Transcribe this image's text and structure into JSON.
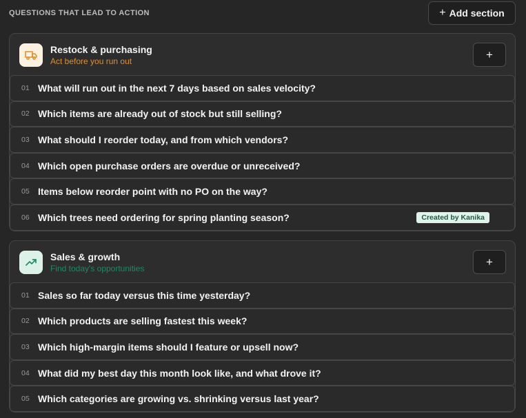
{
  "header": {
    "title": "QUESTIONS THAT LEAD TO ACTION",
    "add_section_label": "Add section",
    "add_icon": "+"
  },
  "sections": [
    {
      "title": "Restock & purchasing",
      "subtitle": "Act before you run out",
      "icon": "truck-icon",
      "accent": "#e0902e",
      "icon_bg": "#fdf1df",
      "add_label": "+",
      "questions": [
        {
          "num": "01",
          "text": "What will run out in the next 7 days based on sales velocity?"
        },
        {
          "num": "02",
          "text": "Which items are already out of stock but still selling?"
        },
        {
          "num": "03",
          "text": "What should I reorder today, and from which vendors?"
        },
        {
          "num": "04",
          "text": "Which open purchase orders are overdue or unreceived?"
        },
        {
          "num": "05",
          "text": "Items below reorder point with no PO on the way?"
        },
        {
          "num": "06",
          "text": "Which trees need ordering for spring planting season?",
          "badge": "Created by Kanika"
        }
      ]
    },
    {
      "title": "Sales & growth",
      "subtitle": "Find today's opportunities",
      "icon": "trending-up-icon",
      "accent": "#1f8a63",
      "icon_bg": "#dcf2e9",
      "add_label": "+",
      "questions": [
        {
          "num": "01",
          "text": "Sales so far today versus this time yesterday?"
        },
        {
          "num": "02",
          "text": "Which products are selling fastest this week?"
        },
        {
          "num": "03",
          "text": "Which high-margin items should I feature or upsell now?"
        },
        {
          "num": "04",
          "text": "What did my best day this month look like, and what drove it?"
        },
        {
          "num": "05",
          "text": "Which categories are growing vs. shrinking versus last year?"
        }
      ]
    }
  ]
}
